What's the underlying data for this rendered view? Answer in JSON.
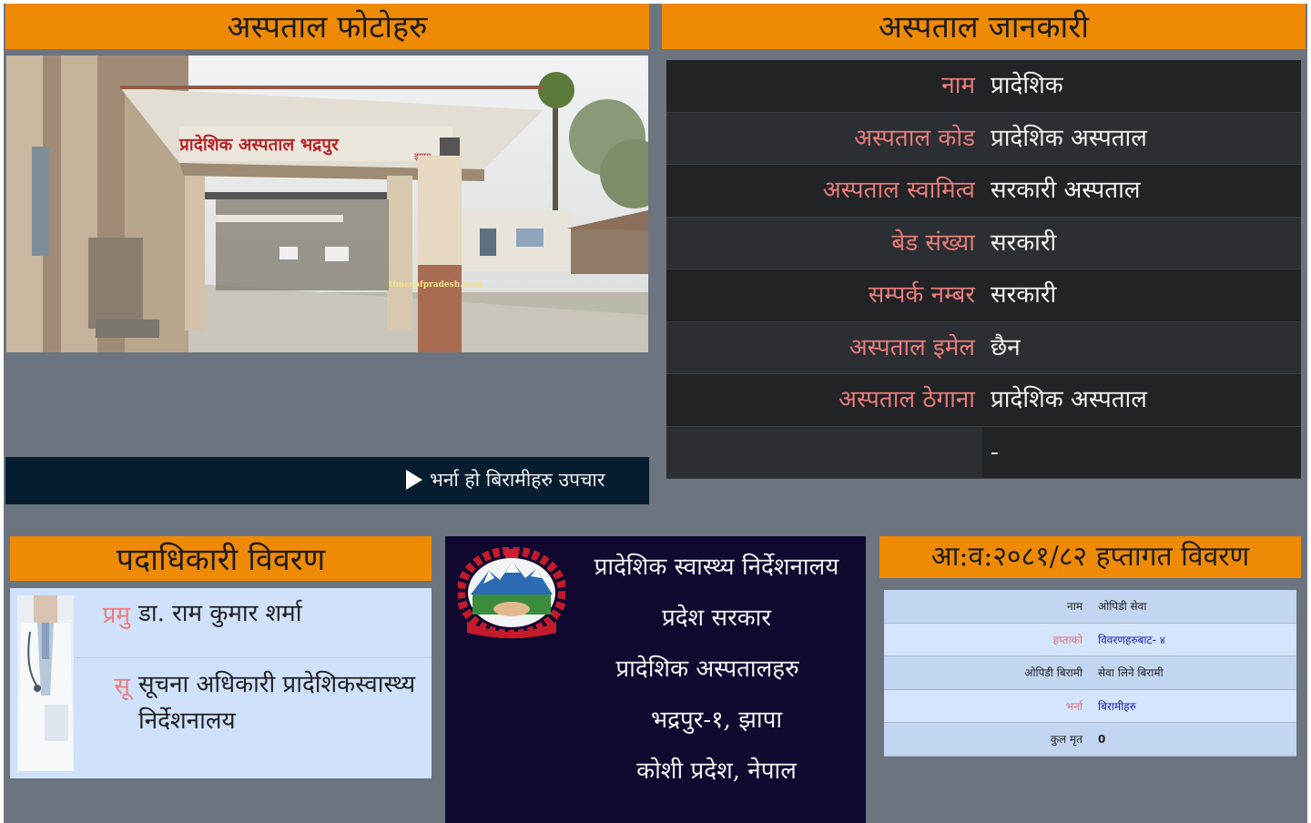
{
  "headers": {
    "photo": "अस्पताल फोटोहरु",
    "info": "अस्पताल जानकारी",
    "officials": "पदाधिकारी विवरण",
    "hmis": "आ:व:२०८१/८२ हप्तागत विवरण"
  },
  "photo": {
    "sign_text": "प्रादेशिक अस्पताल भद्रपुर",
    "sign_suffix": "झापा",
    "watermark": "timesofpradesh.com"
  },
  "ticker": {
    "text": "भर्ना हो बिरामीहरु उपचार"
  },
  "info_rows": [
    {
      "label": "नाम",
      "value": "प्रादेशिक"
    },
    {
      "label": "अस्पताल कोड",
      "value": "प्रादेशिक अस्पताल"
    },
    {
      "label": "अस्पताल स्वामित्व",
      "value": "सरकारी अस्पताल"
    },
    {
      "label": "बेड संख्या",
      "value": "सरकारी"
    },
    {
      "label": "सम्पर्क नम्बर",
      "value": "सरकारी"
    },
    {
      "label": "अस्पताल इमेल",
      "value": "छैन"
    },
    {
      "label": "अस्पताल ठेगाना",
      "value": "प्रादेशिक अस्पताल"
    },
    {
      "label": "",
      "value": "-"
    }
  ],
  "officials": [
    {
      "role": "प्रमु",
      "name": "डा. राम कुमार शर्मा"
    },
    {
      "role": "सू",
      "name": "सूचना अधिकारी प्रादेशिकस्वास्थ्यनिर्देशनालय"
    }
  ],
  "center": {
    "line1": "प्रादेशिक स्वास्थ्य निर्देशनालय",
    "line2": "",
    "line3": "प्रदेश सरकार",
    "line4": "प्रादेशिक अस्पतालहरु",
    "line5": "भद्रपुर-१, झापा",
    "line6": "कोशी प्रदेश, नेपाल"
  },
  "hmis_rows": [
    {
      "label": "नाम",
      "value": "ओपिडी सेवा",
      "bold": false
    },
    {
      "label": "हप्ताको",
      "value": "विवरणहरुबाट- ४",
      "bold": false
    },
    {
      "label": "ओपिडी बिरामी",
      "value": "सेवा लिने बिरामी",
      "bold": false
    },
    {
      "label": "भर्ना",
      "value": "बिरामीहरु",
      "bold": false
    },
    {
      "label": "कुल मृत",
      "value": "0",
      "bold": true
    }
  ],
  "colors": {
    "header_orange": "#ef8a04",
    "page_gray": "#6c7480",
    "ticker_navy": "#061d30",
    "center_navy": "#110830",
    "label_red": "#e77c7c"
  }
}
